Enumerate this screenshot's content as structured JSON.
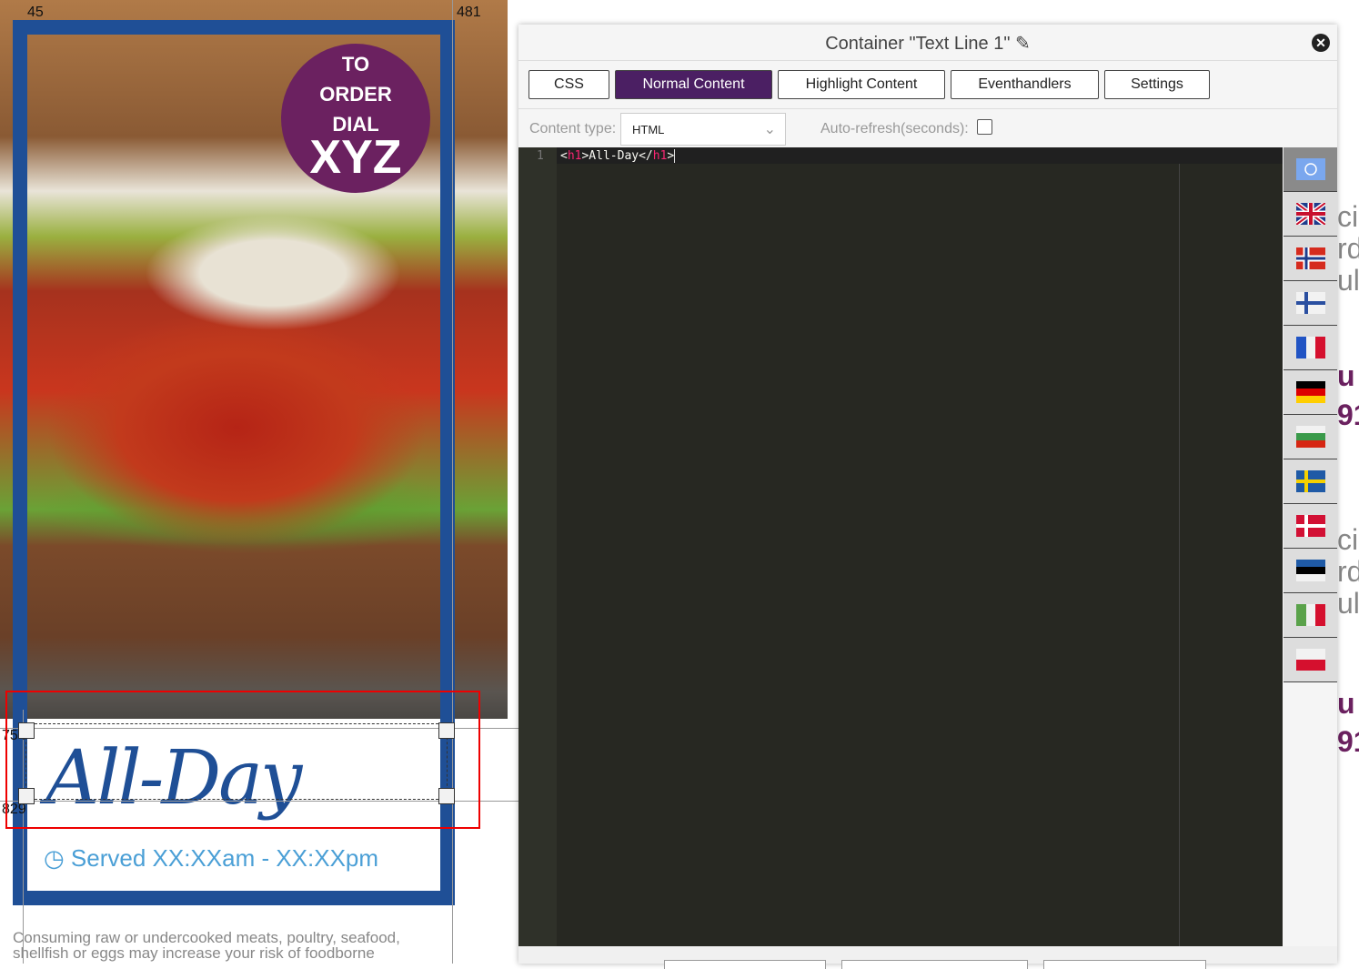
{
  "poster": {
    "ruler_left": "45",
    "ruler_right": "481",
    "guide_top": "754",
    "guide_bottom": "829",
    "badge_line1": "TO",
    "badge_line2": "ORDER",
    "badge_line3": "DIAL",
    "badge_big": "XYZ",
    "heading": "All-Day",
    "served": "Served XX:XXam - XX:XXpm",
    "disclaimer": "Consuming raw or undercooked meats, poultry, seafood, shellfish or eggs may increase your risk of foodborne",
    "frame_color": "#1f4f96",
    "badge_color": "#6b2160"
  },
  "panel": {
    "title": "Container \"Text Line 1\"",
    "tabs": [
      {
        "label": "CSS"
      },
      {
        "label": "Normal Content",
        "active": true
      },
      {
        "label": "Highlight Content"
      },
      {
        "label": "Eventhandlers"
      },
      {
        "label": "Settings"
      }
    ],
    "content_type_label": "Content type:",
    "content_type_value": "HTML",
    "autorefresh_label": "Auto-refresh(seconds):",
    "autorefresh_checked": false,
    "editor": {
      "line_number": "1",
      "open_tag_lt": "<",
      "tag": "h1",
      "text": ">All-Day</",
      "close_gt": ">"
    },
    "languages": [
      "united-nations",
      "united-kingdom",
      "norway",
      "finland",
      "france",
      "germany",
      "bulgaria",
      "sweden",
      "denmark",
      "estonia",
      "italy",
      "poland"
    ],
    "selected_language": "united-nations"
  },
  "background_fragments": [
    "ci",
    "rd",
    "ult",
    "u",
    "91",
    "ci",
    "rd",
    "ult",
    "u",
    "91"
  ]
}
